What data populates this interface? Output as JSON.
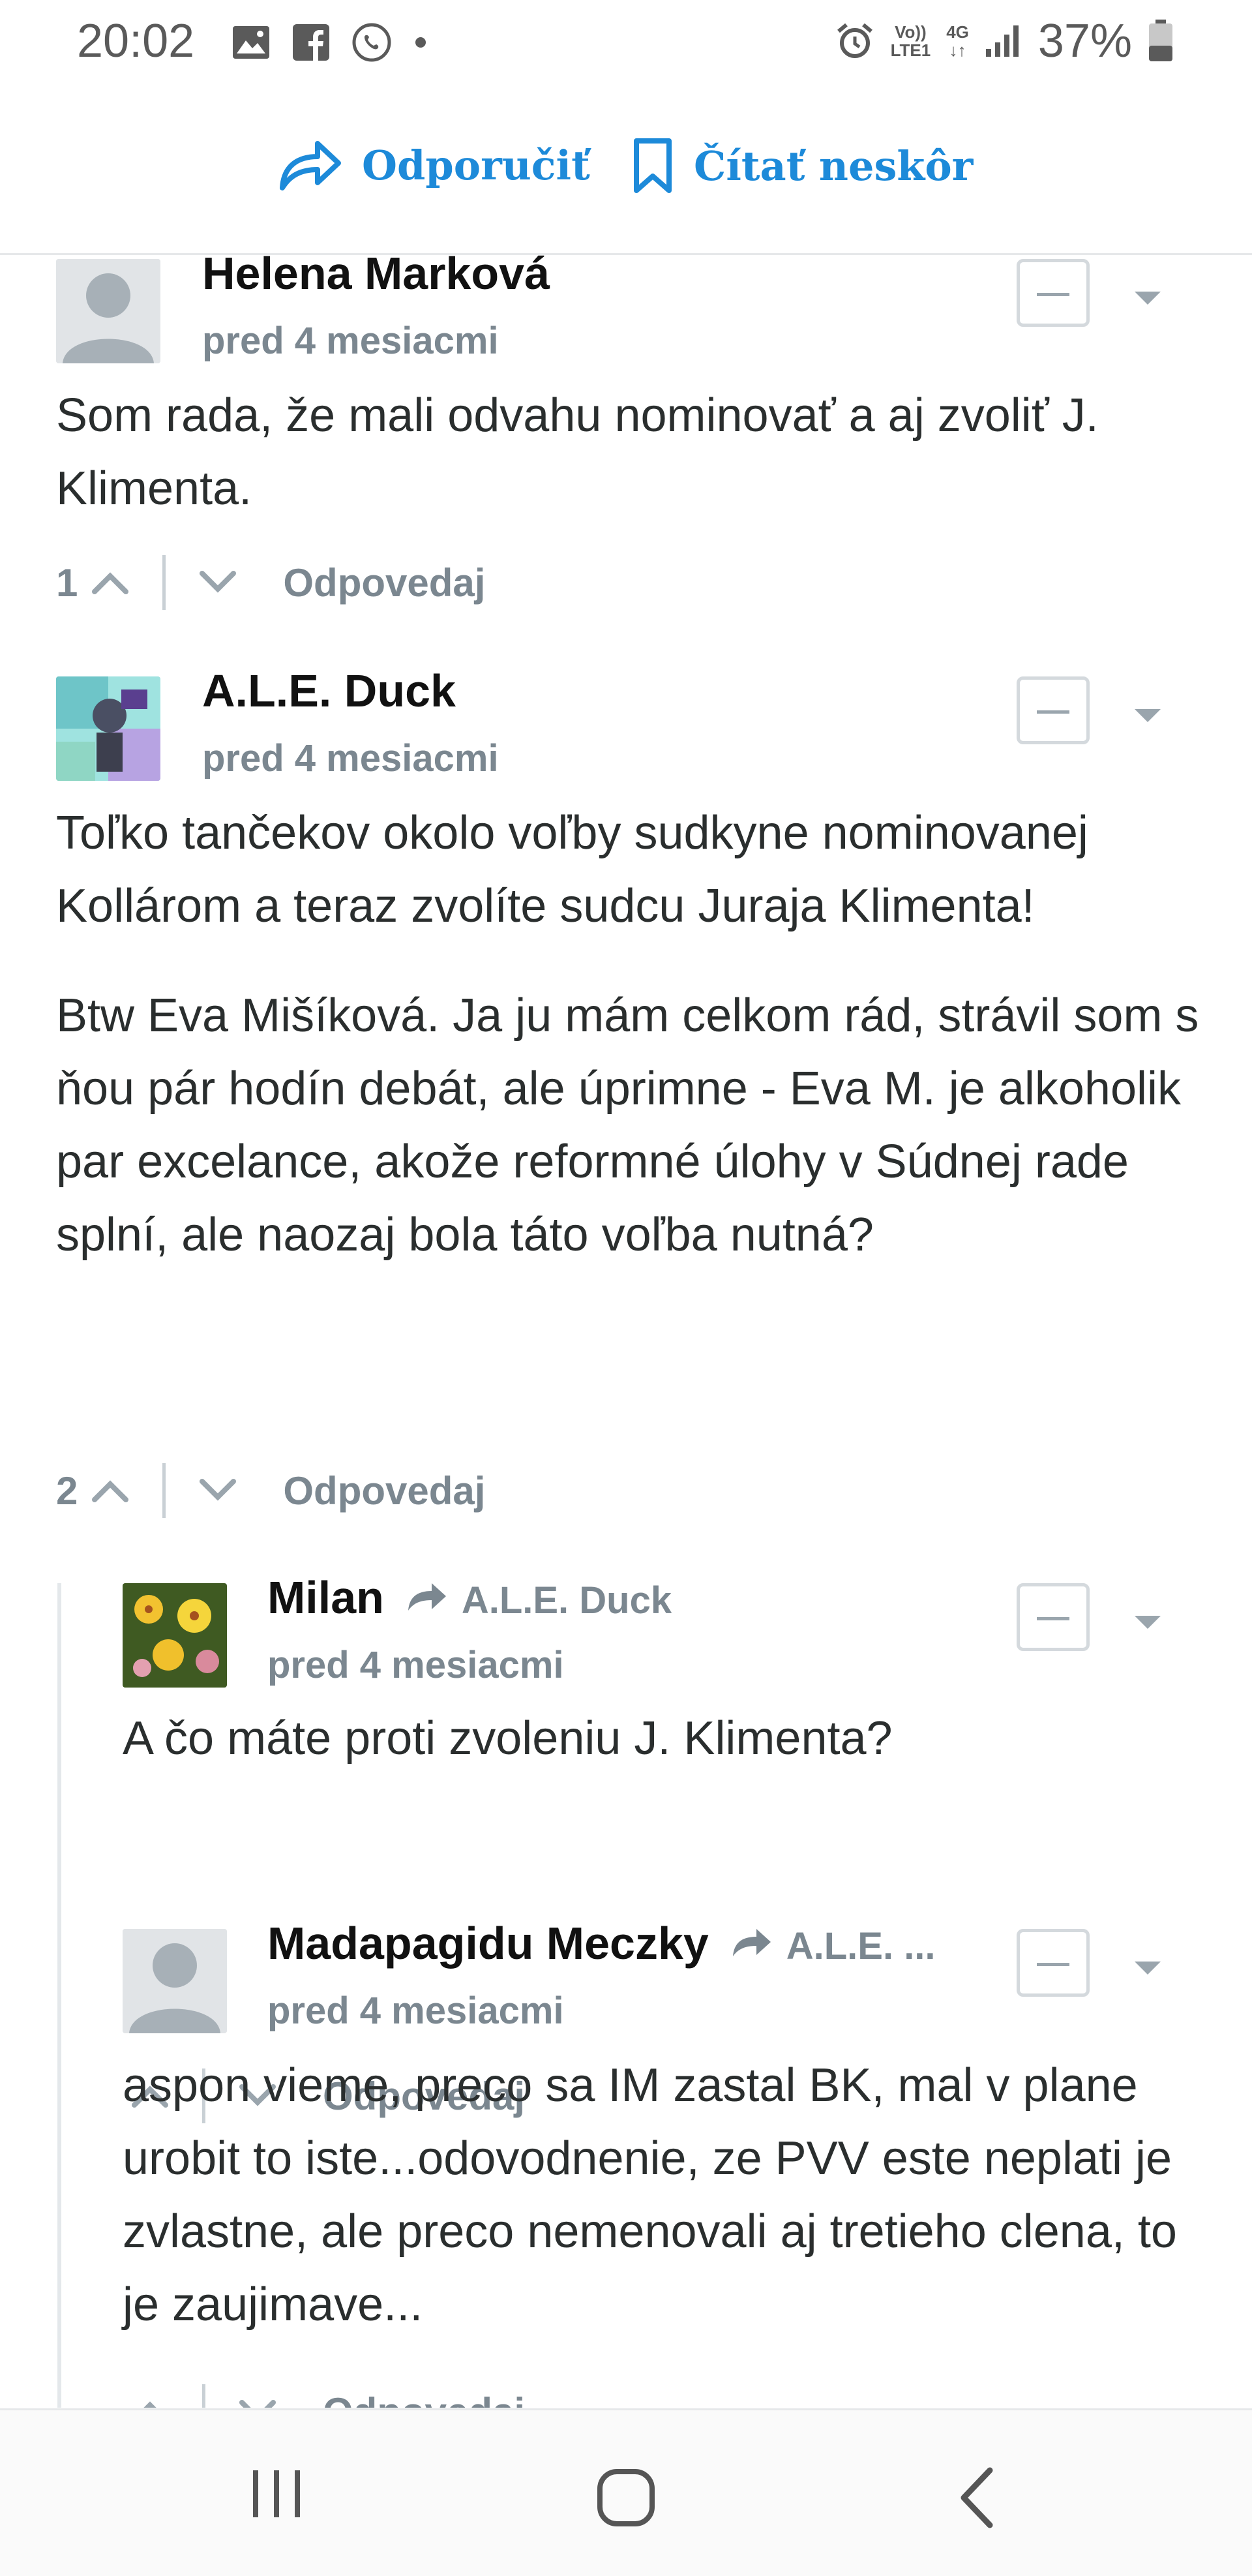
{
  "status_bar": {
    "time": "20:02",
    "network_top": "Vo))",
    "network_bottom": "LTE1",
    "network_type": "4G",
    "battery": "37%"
  },
  "action_bar": {
    "recommend_label": "Odporučiť",
    "read_later_label": "Čítať neskôr",
    "accent_color": "#1d8ad9"
  },
  "comments": [
    {
      "author": "Helena Marková",
      "time": "pred 4 mesiacmi",
      "paragraphs": [
        "Som rada, že mali odvahu nominovať a aj zvoliť J. Klimenta."
      ],
      "votes": "1",
      "reply_label": "Odpovedaj"
    },
    {
      "author": "A.L.E. Duck",
      "time": "pred 4 mesiacmi",
      "paragraphs": [
        "Toľko tančekov okolo voľby sudkyne nominovanej Kollárom a teraz zvolíte sudcu Juraja Klimenta!",
        "Btw Eva Mišíková. Ja ju mám celkom rád, strávil som s ňou pár hodín debát, ale úprimne - Eva M. je alkoholik par excelance, akože reformné úlohy v Súdnej rade splní, ale naozaj bola táto voľba nutná?"
      ],
      "votes": "2",
      "reply_label": "Odpovedaj"
    },
    {
      "author": "Milan",
      "reply_to": "A.L.E. Duck",
      "time": "pred 4 mesiacmi",
      "paragraphs": [
        "A čo máte proti zvoleniu J. Klimenta?"
      ],
      "votes": "",
      "reply_label": "Odpovedaj"
    },
    {
      "author": "Madapagidu Meczky",
      "reply_to": "A.L.E. ...",
      "time": "pred 4 mesiacmi",
      "paragraphs": [
        "aspon vieme, preco sa IM zastal BK, mal v plane urobit to iste...odovodnenie, ze PVV este neplati je zvlastne, ale preco nemenovali aj tretieho clena, to je zaujimave..."
      ],
      "votes": "",
      "reply_label": "Odpovedaj"
    }
  ]
}
